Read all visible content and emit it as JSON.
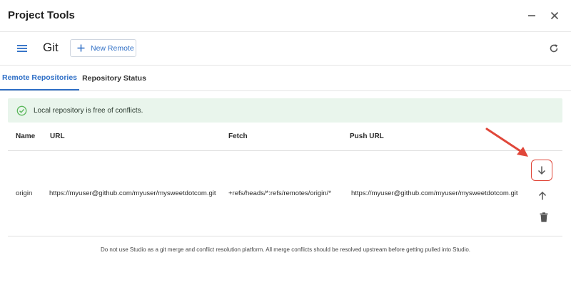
{
  "window": {
    "title": "Project Tools"
  },
  "toolbar": {
    "app_name": "Git",
    "new_remote_label": "New Remote"
  },
  "tabs": [
    {
      "label": "Remote Repositories",
      "active": true
    },
    {
      "label": "Repository Status",
      "active": false
    }
  ],
  "alert": {
    "text": "Local repository is free of conflicts."
  },
  "table": {
    "headers": {
      "name": "Name",
      "url": "URL",
      "fetch": "Fetch",
      "push_url": "Push URL"
    },
    "rows": [
      {
        "name": "origin",
        "url": "https://myuser@github.com/myuser/mysweetdotcom.git",
        "fetch": "+refs/heads/*:refs/remotes/origin/*",
        "push_url": "https://myuser@github.com/myuser/mysweetdotcom.git"
      }
    ]
  },
  "footer": {
    "text": "Do not use Studio as a git merge and conflict resolution platform. All merge conflicts should be resolved upstream before getting pulled into Studio."
  },
  "icons": {
    "minimize": "minimize-icon",
    "close": "close-icon",
    "menu": "hamburger-menu-icon",
    "add": "plus-icon",
    "refresh": "refresh-icon",
    "success": "check-circle-icon",
    "pull": "arrow-down-icon",
    "push": "arrow-up-icon",
    "delete": "trash-icon"
  },
  "colors": {
    "accent": "#2f6fc6",
    "success_bg": "#e9f5ec",
    "success_icon": "#5cb85c",
    "highlight": "#e0473a"
  }
}
